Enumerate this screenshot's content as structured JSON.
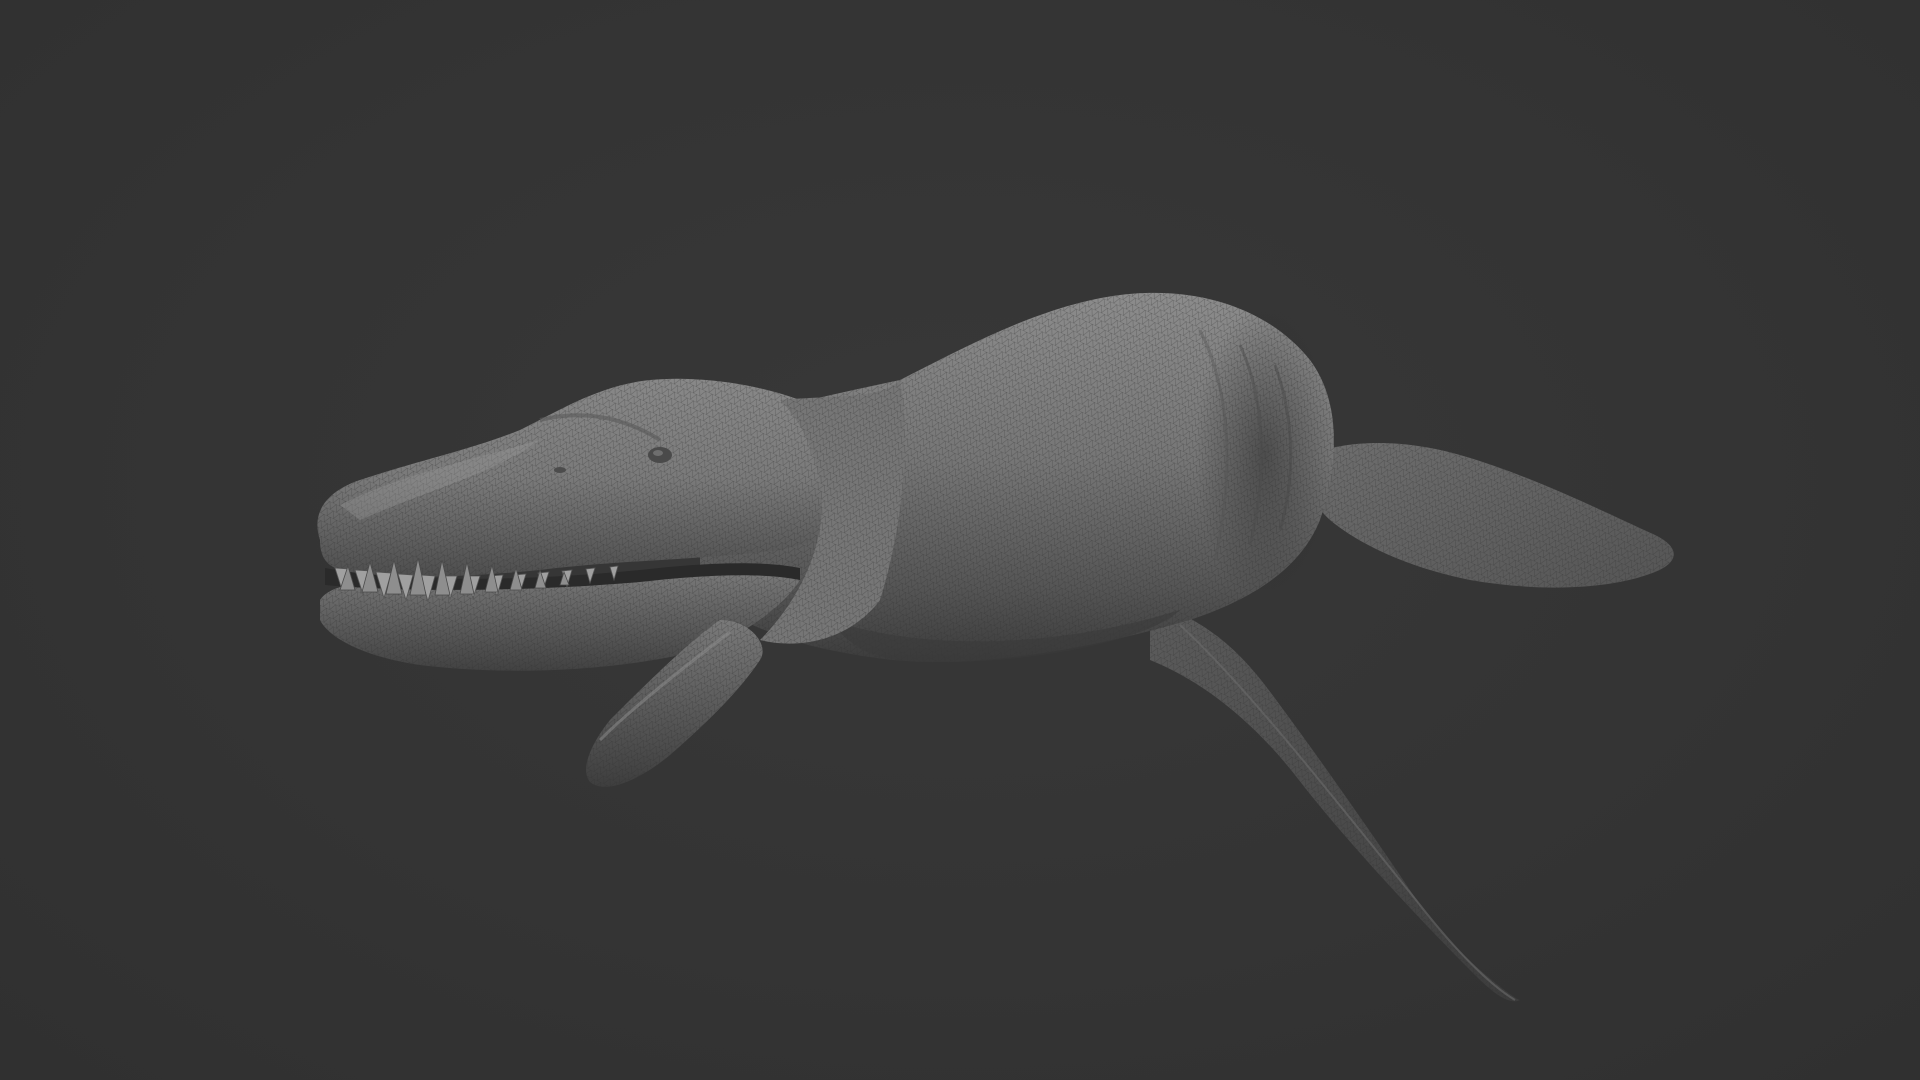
{
  "scene": {
    "background_color": "#333333",
    "subject": "sea-reptile-sculpt",
    "render_style": "clay-wireframe",
    "mesh_colors": {
      "highlight": "#8e8e8e",
      "base": "#666666",
      "shadow": "#3a3a3a",
      "wire": "#4a4a4a"
    }
  }
}
